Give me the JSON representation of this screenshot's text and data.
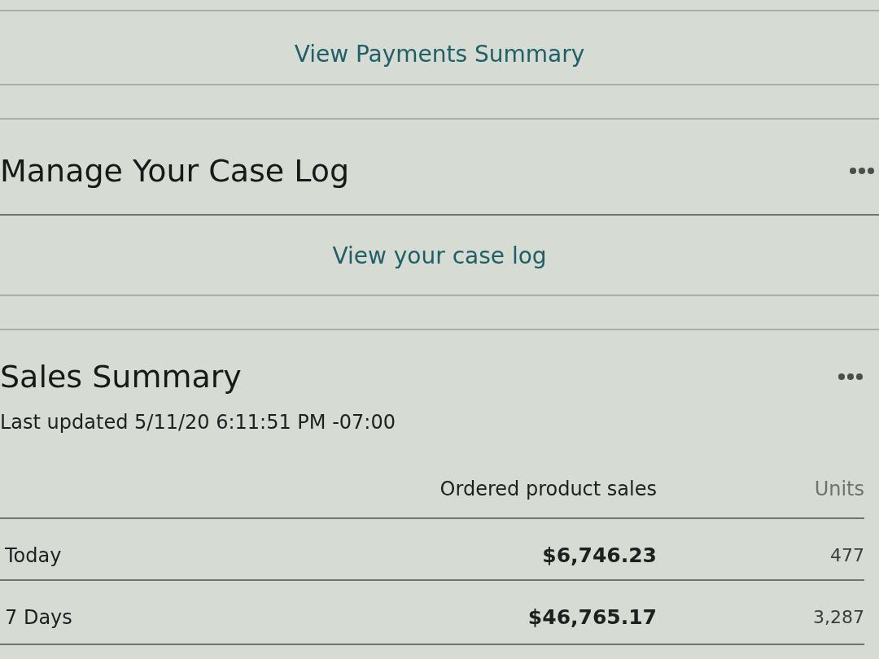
{
  "payments": {
    "link": "View Payments Summary"
  },
  "case_log": {
    "title": "Manage Your Case Log",
    "link": "View your case log"
  },
  "sales_summary": {
    "title": "Sales Summary",
    "updated": "Last updated 5/11/20 6:11:51 PM -07:00",
    "table": {
      "columns": [
        {
          "label": "Ordered product sales",
          "muted": false
        },
        {
          "label": "Units",
          "muted": true
        }
      ],
      "rows": [
        {
          "period": "Today",
          "cells": [
            "$6,746.23",
            "477"
          ]
        },
        {
          "period": "7 Days",
          "cells": [
            "$46,765.17",
            "3,287"
          ]
        }
      ]
    }
  }
}
